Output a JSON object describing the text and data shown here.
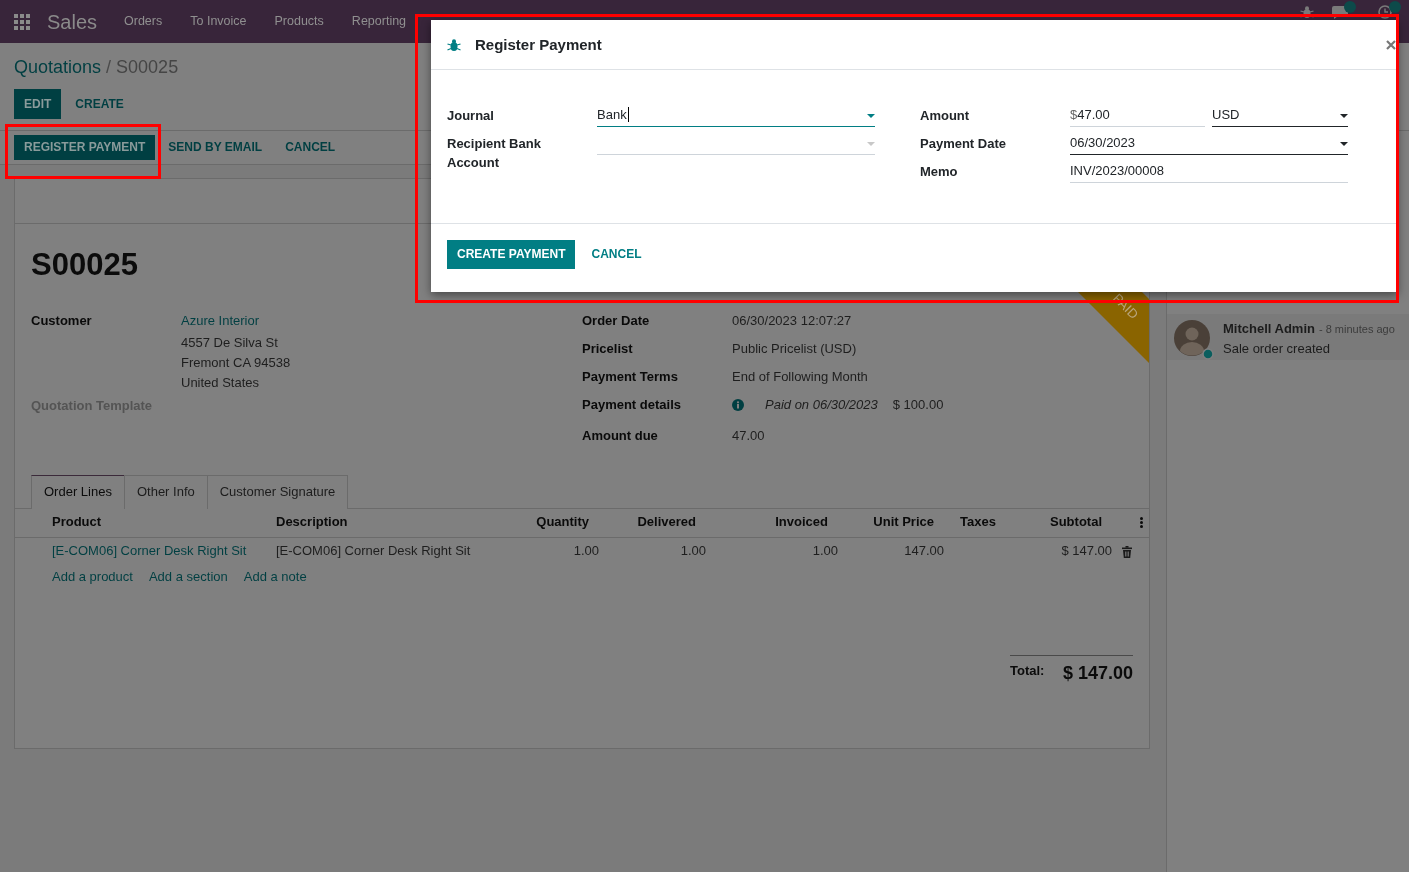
{
  "navbar": {
    "app_name": "Sales",
    "menu": [
      "Orders",
      "To Invoice",
      "Products",
      "Reporting"
    ]
  },
  "breadcrumb": {
    "items": [
      "Quotations",
      "S00025"
    ],
    "separator": "/"
  },
  "control_buttons": [
    {
      "label": "EDIT",
      "kind": "primary"
    },
    {
      "label": "CREATE",
      "kind": "link"
    }
  ],
  "status_buttons": [
    {
      "label": "REGISTER PAYMENT",
      "kind": "primary",
      "highlighted": true
    },
    {
      "label": "SEND BY EMAIL",
      "kind": "link",
      "highlighted": false
    },
    {
      "label": "CANCEL",
      "kind": "link",
      "highlighted": false
    }
  ],
  "sheet": {
    "ribbon": "PAID",
    "title": "S00025",
    "left_fields": [
      {
        "label": "Customer",
        "kind": "address",
        "link": "Azure Interior",
        "lines": [
          "4557 De Silva St",
          "Fremont CA 94538",
          "United States"
        ]
      },
      {
        "label": "Quotation Template",
        "kind": "empty"
      }
    ],
    "right_fields": [
      {
        "label": "Order Date",
        "kind": "text",
        "value": "06/30/2023 12:07:27"
      },
      {
        "label": "Pricelist",
        "kind": "text",
        "value": "Public Pricelist (USD)"
      },
      {
        "label": "Payment Terms",
        "kind": "text",
        "value": "End of Following Month"
      },
      {
        "label": "Payment details",
        "kind": "payment",
        "note": "Paid on 06/30/2023",
        "amount": "$ 100.00"
      },
      {
        "label": "Amount due",
        "kind": "text",
        "value": "47.00"
      }
    ],
    "tabs": [
      {
        "label": "Order Lines",
        "selected": true
      },
      {
        "label": "Other Info",
        "selected": false
      },
      {
        "label": "Customer Signature",
        "selected": false
      }
    ],
    "table": {
      "columns": [
        {
          "label": "Product",
          "kind": "link"
        },
        {
          "label": "Description",
          "kind": "text"
        },
        {
          "label": "Quantity",
          "kind": "number"
        },
        {
          "label": "Delivered",
          "kind": "number"
        },
        {
          "label": "Invoiced",
          "kind": "number"
        },
        {
          "label": "Unit Price",
          "kind": "number"
        },
        {
          "label": "Taxes",
          "kind": "text"
        },
        {
          "label": "Subtotal",
          "kind": "number"
        }
      ],
      "rows": [
        {
          "cells": [
            "[E-COM06] Corner Desk Right Sit",
            "[E-COM06] Corner Desk Right Sit",
            "1.00",
            "1.00",
            "1.00",
            "147.00",
            null,
            "$ 147.00"
          ]
        }
      ],
      "add_links": [
        "Add a product",
        "Add a section",
        "Add a note"
      ]
    },
    "total": {
      "label": "Total:",
      "value": "$ 147.00"
    }
  },
  "chatter": {
    "messages": [
      {
        "author": "Mitchell Admin",
        "time": "- 8 minutes ago",
        "body": "Sale order created",
        "online": true
      }
    ]
  },
  "dialog": {
    "title": "Register Payment",
    "highlighted": true,
    "left_fields": [
      {
        "label": "Journal",
        "kind": "select",
        "value": "Bank",
        "focused": true,
        "required": true
      },
      {
        "label": "Recipient Bank Account",
        "kind": "select",
        "focused": false,
        "required": false
      }
    ],
    "right_fields": [
      {
        "label": "Amount",
        "kind": "monetary",
        "prefix": "$",
        "value": "47.00",
        "focused": false,
        "required": false,
        "currency": {
          "value": "USD",
          "required": true
        }
      },
      {
        "label": "Payment Date",
        "kind": "date",
        "value": "06/30/2023",
        "focused": false,
        "required": true
      },
      {
        "label": "Memo",
        "kind": "text",
        "value": "INV/2023/00008",
        "focused": false,
        "required": false
      }
    ],
    "buttons": [
      {
        "label": "CREATE PAYMENT",
        "kind": "primary"
      },
      {
        "label": "CANCEL",
        "kind": "link"
      }
    ]
  }
}
